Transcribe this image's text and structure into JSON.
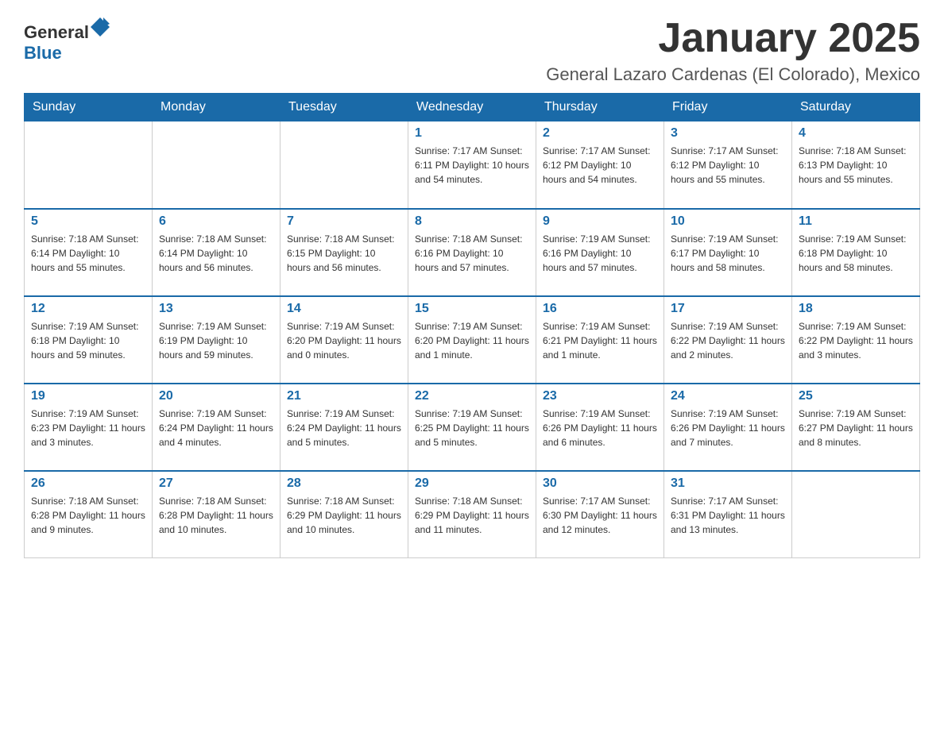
{
  "logo": {
    "general": "General",
    "blue": "Blue"
  },
  "title": "January 2025",
  "subtitle": "General Lazaro Cardenas (El Colorado), Mexico",
  "days_of_week": [
    "Sunday",
    "Monday",
    "Tuesday",
    "Wednesday",
    "Thursday",
    "Friday",
    "Saturday"
  ],
  "weeks": [
    [
      {
        "day": "",
        "info": ""
      },
      {
        "day": "",
        "info": ""
      },
      {
        "day": "",
        "info": ""
      },
      {
        "day": "1",
        "info": "Sunrise: 7:17 AM\nSunset: 6:11 PM\nDaylight: 10 hours and 54 minutes."
      },
      {
        "day": "2",
        "info": "Sunrise: 7:17 AM\nSunset: 6:12 PM\nDaylight: 10 hours and 54 minutes."
      },
      {
        "day": "3",
        "info": "Sunrise: 7:17 AM\nSunset: 6:12 PM\nDaylight: 10 hours and 55 minutes."
      },
      {
        "day": "4",
        "info": "Sunrise: 7:18 AM\nSunset: 6:13 PM\nDaylight: 10 hours and 55 minutes."
      }
    ],
    [
      {
        "day": "5",
        "info": "Sunrise: 7:18 AM\nSunset: 6:14 PM\nDaylight: 10 hours and 55 minutes."
      },
      {
        "day": "6",
        "info": "Sunrise: 7:18 AM\nSunset: 6:14 PM\nDaylight: 10 hours and 56 minutes."
      },
      {
        "day": "7",
        "info": "Sunrise: 7:18 AM\nSunset: 6:15 PM\nDaylight: 10 hours and 56 minutes."
      },
      {
        "day": "8",
        "info": "Sunrise: 7:18 AM\nSunset: 6:16 PM\nDaylight: 10 hours and 57 minutes."
      },
      {
        "day": "9",
        "info": "Sunrise: 7:19 AM\nSunset: 6:16 PM\nDaylight: 10 hours and 57 minutes."
      },
      {
        "day": "10",
        "info": "Sunrise: 7:19 AM\nSunset: 6:17 PM\nDaylight: 10 hours and 58 minutes."
      },
      {
        "day": "11",
        "info": "Sunrise: 7:19 AM\nSunset: 6:18 PM\nDaylight: 10 hours and 58 minutes."
      }
    ],
    [
      {
        "day": "12",
        "info": "Sunrise: 7:19 AM\nSunset: 6:18 PM\nDaylight: 10 hours and 59 minutes."
      },
      {
        "day": "13",
        "info": "Sunrise: 7:19 AM\nSunset: 6:19 PM\nDaylight: 10 hours and 59 minutes."
      },
      {
        "day": "14",
        "info": "Sunrise: 7:19 AM\nSunset: 6:20 PM\nDaylight: 11 hours and 0 minutes."
      },
      {
        "day": "15",
        "info": "Sunrise: 7:19 AM\nSunset: 6:20 PM\nDaylight: 11 hours and 1 minute."
      },
      {
        "day": "16",
        "info": "Sunrise: 7:19 AM\nSunset: 6:21 PM\nDaylight: 11 hours and 1 minute."
      },
      {
        "day": "17",
        "info": "Sunrise: 7:19 AM\nSunset: 6:22 PM\nDaylight: 11 hours and 2 minutes."
      },
      {
        "day": "18",
        "info": "Sunrise: 7:19 AM\nSunset: 6:22 PM\nDaylight: 11 hours and 3 minutes."
      }
    ],
    [
      {
        "day": "19",
        "info": "Sunrise: 7:19 AM\nSunset: 6:23 PM\nDaylight: 11 hours and 3 minutes."
      },
      {
        "day": "20",
        "info": "Sunrise: 7:19 AM\nSunset: 6:24 PM\nDaylight: 11 hours and 4 minutes."
      },
      {
        "day": "21",
        "info": "Sunrise: 7:19 AM\nSunset: 6:24 PM\nDaylight: 11 hours and 5 minutes."
      },
      {
        "day": "22",
        "info": "Sunrise: 7:19 AM\nSunset: 6:25 PM\nDaylight: 11 hours and 5 minutes."
      },
      {
        "day": "23",
        "info": "Sunrise: 7:19 AM\nSunset: 6:26 PM\nDaylight: 11 hours and 6 minutes."
      },
      {
        "day": "24",
        "info": "Sunrise: 7:19 AM\nSunset: 6:26 PM\nDaylight: 11 hours and 7 minutes."
      },
      {
        "day": "25",
        "info": "Sunrise: 7:19 AM\nSunset: 6:27 PM\nDaylight: 11 hours and 8 minutes."
      }
    ],
    [
      {
        "day": "26",
        "info": "Sunrise: 7:18 AM\nSunset: 6:28 PM\nDaylight: 11 hours and 9 minutes."
      },
      {
        "day": "27",
        "info": "Sunrise: 7:18 AM\nSunset: 6:28 PM\nDaylight: 11 hours and 10 minutes."
      },
      {
        "day": "28",
        "info": "Sunrise: 7:18 AM\nSunset: 6:29 PM\nDaylight: 11 hours and 10 minutes."
      },
      {
        "day": "29",
        "info": "Sunrise: 7:18 AM\nSunset: 6:29 PM\nDaylight: 11 hours and 11 minutes."
      },
      {
        "day": "30",
        "info": "Sunrise: 7:17 AM\nSunset: 6:30 PM\nDaylight: 11 hours and 12 minutes."
      },
      {
        "day": "31",
        "info": "Sunrise: 7:17 AM\nSunset: 6:31 PM\nDaylight: 11 hours and 13 minutes."
      },
      {
        "day": "",
        "info": ""
      }
    ]
  ]
}
